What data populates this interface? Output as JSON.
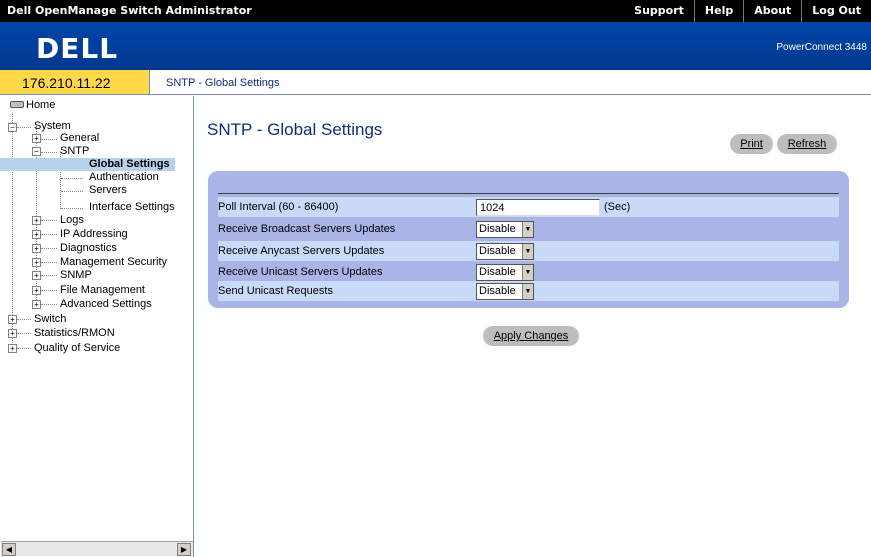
{
  "app": {
    "title": "Dell OpenManage Switch Administrator",
    "nav": [
      "Support",
      "Help",
      "About",
      "Log Out"
    ],
    "logo": "DELL",
    "model": "PowerConnect 3448"
  },
  "ip": "176.210.11.22",
  "breadcrumb": "SNTP - Global Settings",
  "tree": {
    "home": "Home",
    "system": "System",
    "general": "General",
    "sntp": "SNTP",
    "global_settings": "Global Settings",
    "authentication": "Authentication",
    "servers": "Servers",
    "interface_settings": "Interface Settings",
    "logs": "Logs",
    "ip_addressing": "IP Addressing",
    "diagnostics": "Diagnostics",
    "management_security": "Management Security",
    "snmp": "SNMP",
    "file_management": "File Management",
    "advanced_settings": "Advanced Settings",
    "switch": "Switch",
    "statistics_rmon": "Statistics/RMON",
    "quality_of_service": "Quality of Service"
  },
  "page": {
    "title": "SNTP - Global Settings",
    "print_label": "Print",
    "refresh_label": "Refresh",
    "apply_label": "Apply Changes"
  },
  "form": {
    "poll_interval": {
      "label": "Poll Interval (60 - 86400)",
      "value": "1024",
      "unit": "(Sec)"
    },
    "broadcast": {
      "label": "Receive Broadcast Servers Updates",
      "value": "Disable"
    },
    "anycast": {
      "label": "Receive Anycast Servers Updates",
      "value": "Disable"
    },
    "unicast": {
      "label": "Receive Unicast Servers Updates",
      "value": "Disable"
    },
    "send_unicast": {
      "label": "Send Unicast Requests",
      "value": "Disable"
    }
  },
  "colors": {
    "banner": "#003d99",
    "ip_box": "#ffd84a",
    "panel": "#aab4e6",
    "row_light": "#c9d9f8",
    "title_text": "#0f2d7a"
  }
}
